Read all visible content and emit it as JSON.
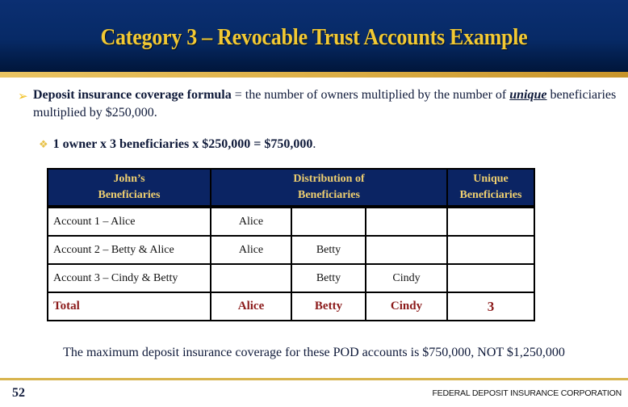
{
  "slide": {
    "title": "Category 3 – Revocable Trust Accounts Example",
    "bullet1": {
      "bold": "Deposit insurance coverage formula",
      "text": " = the number of owners multiplied by the number of ",
      "emphasis": "unique",
      "text2": " beneficiaries multiplied by $250,000."
    },
    "bullet2": {
      "bold": "1 owner x 3 beneficiaries x $250,000 = $750,000",
      "end": "."
    },
    "table": {
      "headers": [
        "John’s Beneficiaries",
        "Distribution of Beneficiaries",
        "Unique Beneficiaries"
      ],
      "rows": [
        [
          "Account 1 – Alice",
          "Alice",
          "",
          "",
          ""
        ],
        [
          "Account 2 – Betty & Alice",
          "Alice",
          "Betty",
          "",
          ""
        ],
        [
          "Account 3 – Cindy & Betty",
          "",
          "Betty",
          "Cindy",
          ""
        ]
      ],
      "total": [
        "Total",
        "Alice",
        "Betty",
        "Cindy",
        "3"
      ]
    },
    "summary": "The maximum deposit insurance coverage for these POD accounts is $750,000, NOT $1,250,000",
    "page_number": "52",
    "organization": "FEDERAL DEPOSIT INSURANCE CORPORATION",
    "icons": {
      "bullet1": "arrow-bullet-icon",
      "bullet2": "diamond-bullet-icon"
    },
    "colors": {
      "header_bg": "#0b2f72",
      "title": "#f2c933",
      "gold_bar": "#ddb048",
      "total_text": "#8b1a1a"
    }
  }
}
